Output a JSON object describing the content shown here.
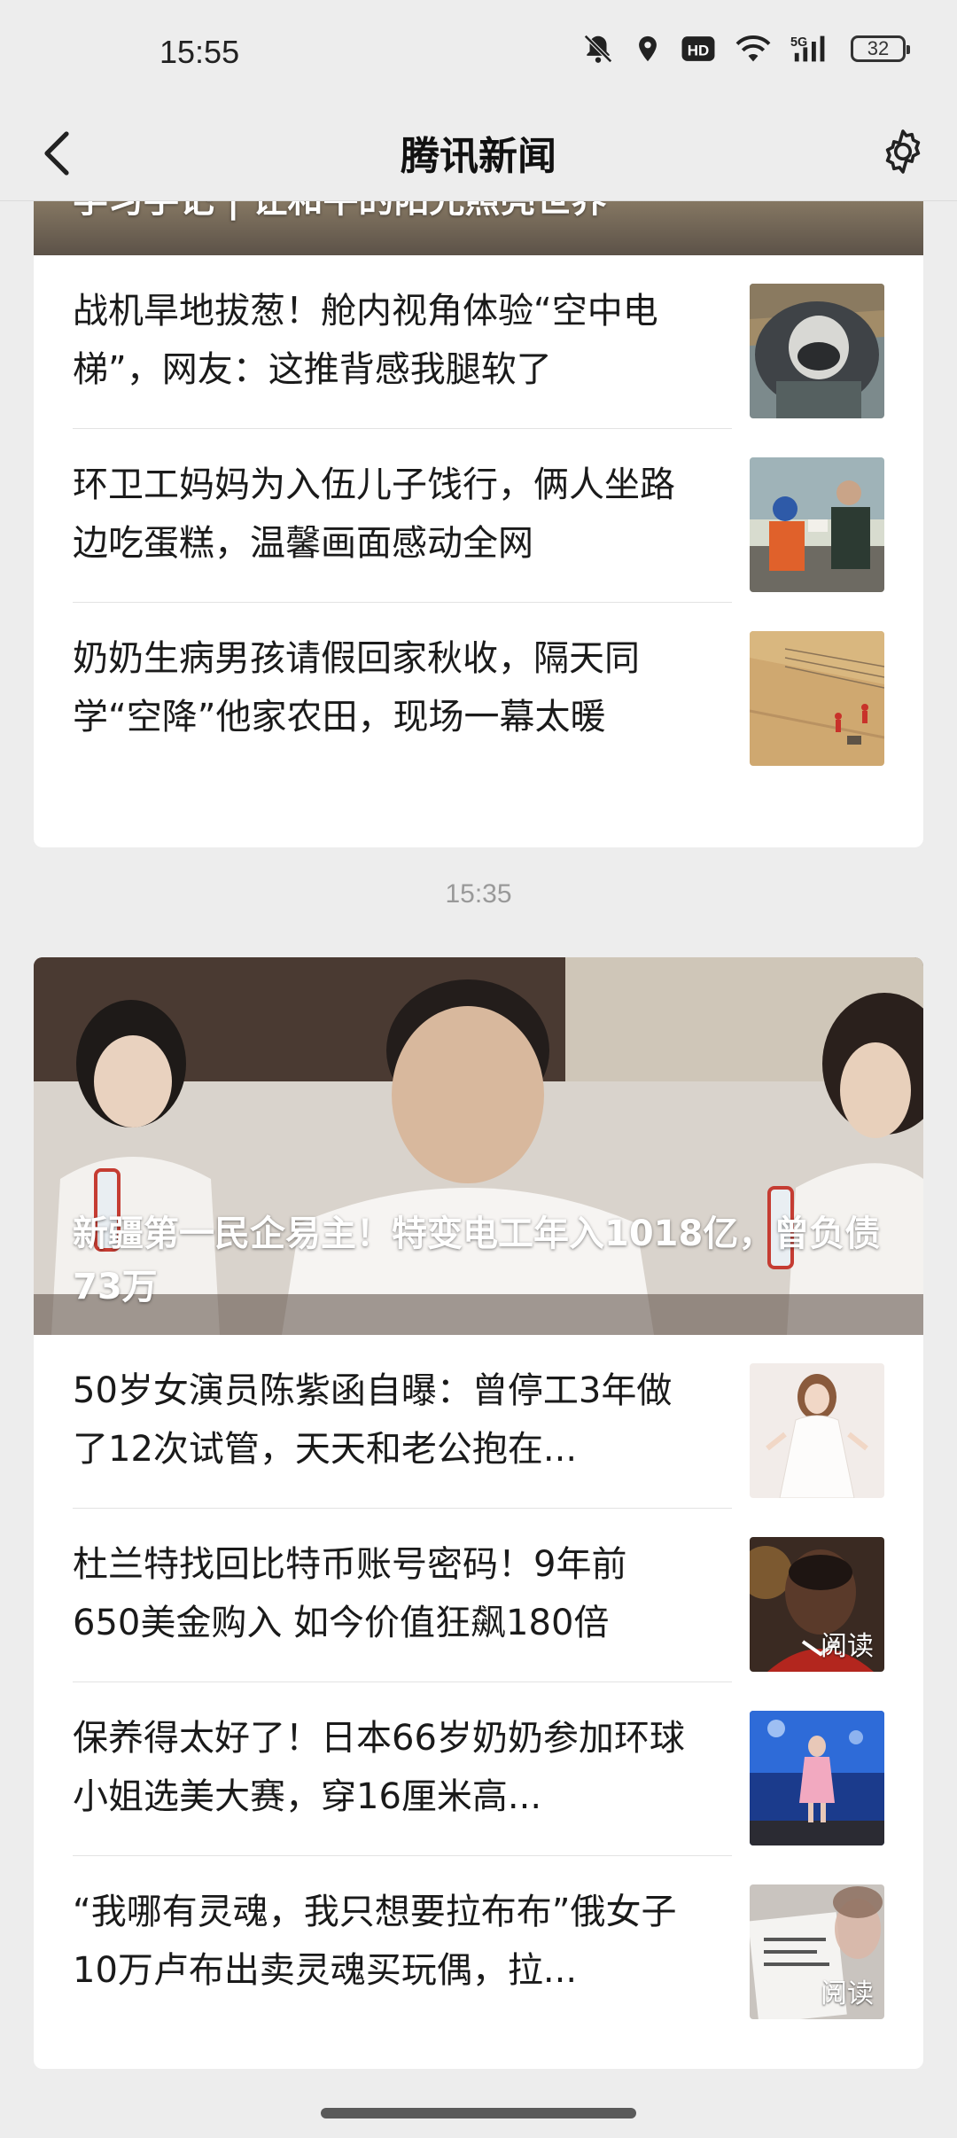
{
  "status_bar": {
    "time": "15:55",
    "battery": "32",
    "icons": [
      "mute-bell-icon",
      "location-icon",
      "hd-icon",
      "wifi-icon",
      "5g-signal-icon",
      "battery-icon"
    ]
  },
  "header": {
    "title": "腾讯新闻",
    "back_icon": "chevron-left-icon",
    "settings_icon": "gear-icon"
  },
  "card1": {
    "hero_title": "学习手记 | 让和平的阳光照亮世界",
    "items": [
      {
        "title": "战机旱地拔葱！舱内视角体验“空中电梯”，网友：这推背感我腿软了",
        "thumb": "fighter-pilot-photo"
      },
      {
        "title": "环卫工妈妈为入伍儿子饯行，俩人坐路边吃蛋糕，温馨画面感动全网",
        "thumb": "mother-son-cake-photo"
      },
      {
        "title": "奶奶生病男孩请假回家秋收，隔天同学“空降”他家农田，现场一幕太暖",
        "thumb": "farm-field-photo"
      }
    ]
  },
  "timestamp": "15:35",
  "card2": {
    "hero_title": "新疆第一民企易主！特变电工年入1018亿，曾负债73万",
    "items": [
      {
        "title": "50岁女演员陈紫函自曝：曾停工3年做了12次试管，天天和老公抱在...",
        "thumb": "actress-white-dress-photo",
        "badge": ""
      },
      {
        "title": "杜兰特找回比特币账号密码！9年前650美金购入 如今价值狂飙180倍",
        "thumb": "basketball-player-photo",
        "badge": "阅读"
      },
      {
        "title": "保养得太好了！日本66岁奶奶参加环球小姐选美大赛，穿16厘米高...",
        "thumb": "pageant-stage-photo",
        "badge": ""
      },
      {
        "title": "“我哪有灵魂，我只想要拉布布”俄女子10万卢布出卖灵魂买玩偶，拉...",
        "thumb": "document-face-photo",
        "badge": "阅读"
      }
    ]
  }
}
